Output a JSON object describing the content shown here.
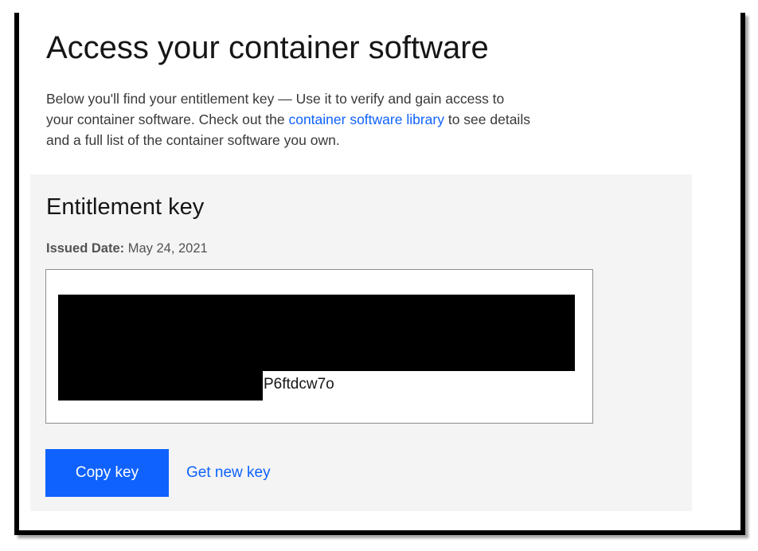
{
  "page": {
    "title": "Access your container software",
    "intro_before_link": "Below you'll find your entitlement key — Use it to verify and gain access to your container software. Check out the ",
    "intro_link": "container software library",
    "intro_after_link": " to see details and a full list of the container software you own."
  },
  "entitlement": {
    "title": "Entitlement key",
    "issued_label": "Issued Date:",
    "issued_value": " May 24, 2021",
    "key_visible_suffix": "P6ftdcw7o"
  },
  "actions": {
    "copy_label": "Copy key",
    "new_key_label": "Get new key"
  },
  "colors": {
    "accent": "#0f62fe",
    "card_background": "#f4f4f4",
    "text_primary": "#161616"
  }
}
